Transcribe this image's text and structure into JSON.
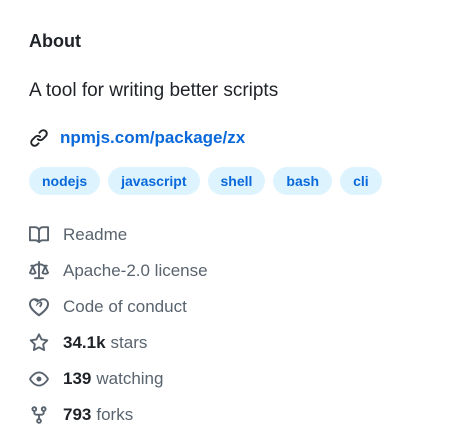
{
  "about": {
    "heading": "About",
    "description": "A tool for writing better scripts",
    "homepage": "npmjs.com/package/zx",
    "topics": [
      "nodejs",
      "javascript",
      "shell",
      "bash",
      "cli"
    ]
  },
  "meta": {
    "readme": "Readme",
    "license": "Apache-2.0 license",
    "conduct": "Code of conduct",
    "stars_count": "34.1k",
    "stars_label": "stars",
    "watching_count": "139",
    "watching_label": "watching",
    "forks_count": "793",
    "forks_label": "forks"
  },
  "icons": [
    "link-icon",
    "book-icon",
    "law-icon",
    "code-of-conduct-icon",
    "star-icon",
    "eye-icon",
    "repo-forked-icon"
  ],
  "colors": {
    "accent": "#0969da",
    "topic_bg": "#ddf4ff",
    "text": "#1f2328",
    "muted": "#59636e"
  }
}
